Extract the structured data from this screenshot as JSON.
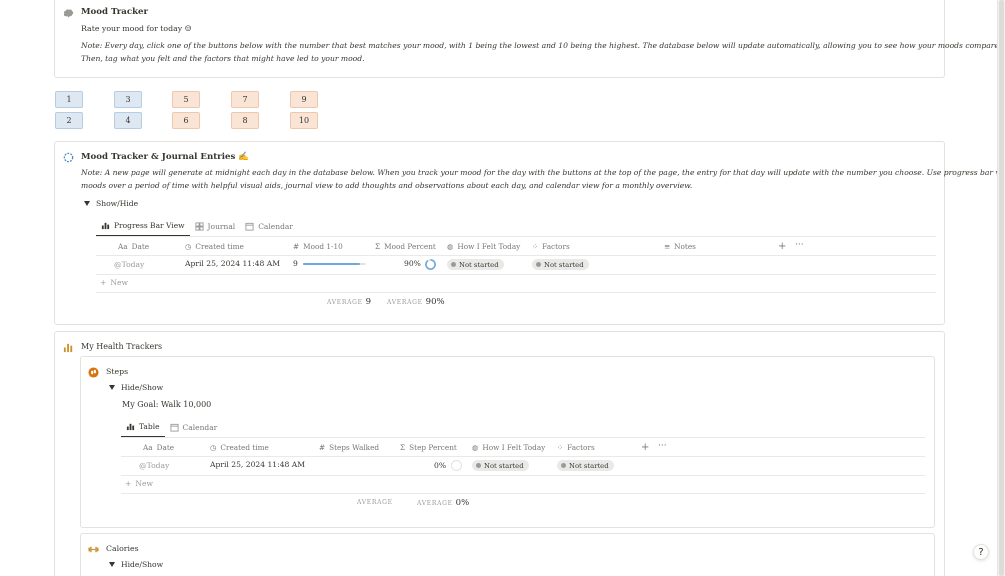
{
  "mood": {
    "title": "Mood Tracker",
    "subtitle": "Rate your mood for today ☺",
    "note_line1": "Note: Every day, click one of the buttons below with the number that best matches your mood, with 1 being the lowest and 10 being the highest. The database below will update automatically, allowing you to see how your moods compare over time!",
    "note_line2": "Then, tag what you felt and the factors that might have led to your mood.",
    "buttons_top": [
      "1",
      "3",
      "5",
      "7",
      "9"
    ],
    "buttons_bottom": [
      "2",
      "4",
      "6",
      "8",
      "10"
    ]
  },
  "journal": {
    "title": "Mood Tracker & Journal Entries ✍",
    "note_line1": "Note: A new page will generate at midnight each day in the database below. When you track your mood for the day with the buttons at the top of the page, the entry for that day will update with the number you choose. Use progress bar view to view your",
    "note_line2": "moods over a period of time with helpful visual aids, journal view to add thoughts and observations about each day, and calendar view for a monthly overview.",
    "toggle_label": "Show/Hide",
    "tabs": [
      "Progress Bar View",
      "Journal",
      "Calendar"
    ],
    "columns": [
      "Date",
      "Created time",
      "Mood 1-10",
      "Mood Percent",
      "How I Felt Today",
      "Factors",
      "Notes"
    ],
    "row": {
      "date": "@Today",
      "created": "April 25, 2024 11:48 AM",
      "mood": "9",
      "mood_progress": 0.9,
      "percent": "90%",
      "felt": "Not started",
      "factors": "Not started"
    },
    "new_label": "New",
    "avg_label": "Average",
    "avg_mood": "9",
    "avg_percent": "90%"
  },
  "health": {
    "title": "My Health Trackers",
    "steps": {
      "title": "Steps",
      "toggle_label": "Hide/Show",
      "goal": "My Goal: Walk 10,000",
      "tabs": [
        "Table",
        "Calendar"
      ],
      "columns": [
        "Date",
        "Created time",
        "Steps Walked",
        "Step Percent",
        "How I Felt Today",
        "Factors"
      ],
      "row": {
        "date": "@Today",
        "created": "April 25, 2024 11:48 AM",
        "percent": "0%",
        "felt": "Not started",
        "factors": "Not started"
      },
      "new_label": "New",
      "avg_label": "Average",
      "avg_percent": "0%"
    },
    "calories": {
      "title": "Calories",
      "toggle_label": "Hide/Show"
    }
  },
  "help_label": "?",
  "colors": {
    "blue_button": "#dde8f2",
    "orange_button": "#f9e4d6",
    "progress": "#6fa8dc"
  }
}
